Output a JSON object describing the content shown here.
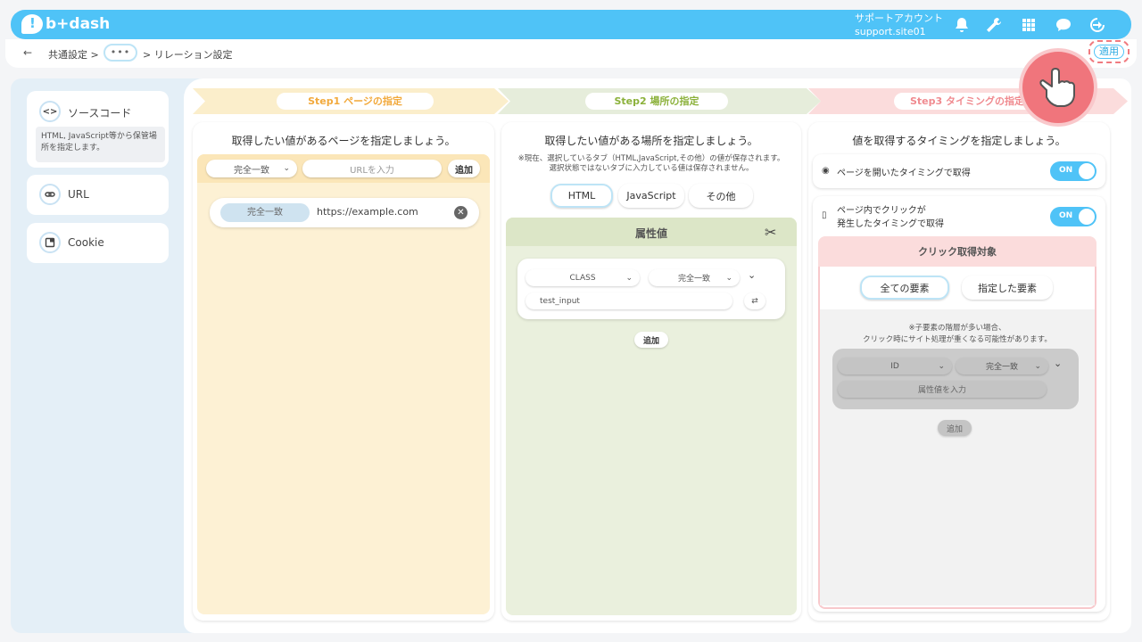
{
  "header": {
    "logo_text": "b+dash",
    "account_name": "サポートアカウント",
    "account_site": "support.site01",
    "icons": [
      "bell-icon",
      "wrench-icon",
      "grid-icon",
      "chat-icon",
      "logout-icon"
    ]
  },
  "breadcrumb": {
    "back": "←",
    "item1": "共通設定 >",
    "more": "•••",
    "item2": "> リレーション設定"
  },
  "apply_label": "適用",
  "sidebar": {
    "source_code": {
      "label": "ソースコード",
      "note": "HTML, JavaScript等から保管場所を指定します。",
      "icon": "<>"
    },
    "url": {
      "label": "URL"
    },
    "cookie": {
      "label": "Cookie"
    }
  },
  "steps": [
    {
      "label": "Step1 ページの指定",
      "color": "#fbeecb",
      "text_color": "#f2a93b"
    },
    {
      "label": "Step2 場所の指定",
      "color": "#e6eddb",
      "text_color": "#8bb13a"
    },
    {
      "label": "Step3 タイミングの指定",
      "color": "#fbdcdc",
      "text_color": "#f08a8f"
    }
  ],
  "col1": {
    "title": "取得したい値があるページを指定しましょう。",
    "match_select": "完全一致",
    "url_placeholder": "URLを入力",
    "add_label": "追加",
    "row_match": "完全一致",
    "row_url": "https://example.com"
  },
  "col2": {
    "title": "取得したい値がある場所を指定しましょう。",
    "note1": "※現在、選択しているタブ（HTML,JavaScript,その他）の値が保存されます。",
    "note2": "選択状態ではないタブに入力している値は保存されません。",
    "tabs": [
      "HTML",
      "JavaScript",
      "その他"
    ],
    "section_title": "属性値",
    "attr_select": "CLASS",
    "match_select": "完全一致",
    "value": "test_input",
    "add_label": "追加"
  },
  "col3": {
    "title": "値を取得するタイミングを指定しましょう。",
    "opt1": "ページを開いたタイミングで取得",
    "opt2a": "ページ内でクリックが",
    "opt2b": "発生したタイミングで取得",
    "toggle_on": "ON",
    "click_target_title": "クリック取得対象",
    "tab_all": "全ての要素",
    "tab_specified": "指定した要素",
    "note1": "※子要素の階層が多い場合、",
    "note2": "クリック時にサイト処理が重くなる可能性があります。",
    "attr_select": "ID",
    "match_select": "完全一致",
    "value_placeholder": "属性値を入力",
    "add_label": "追加"
  }
}
